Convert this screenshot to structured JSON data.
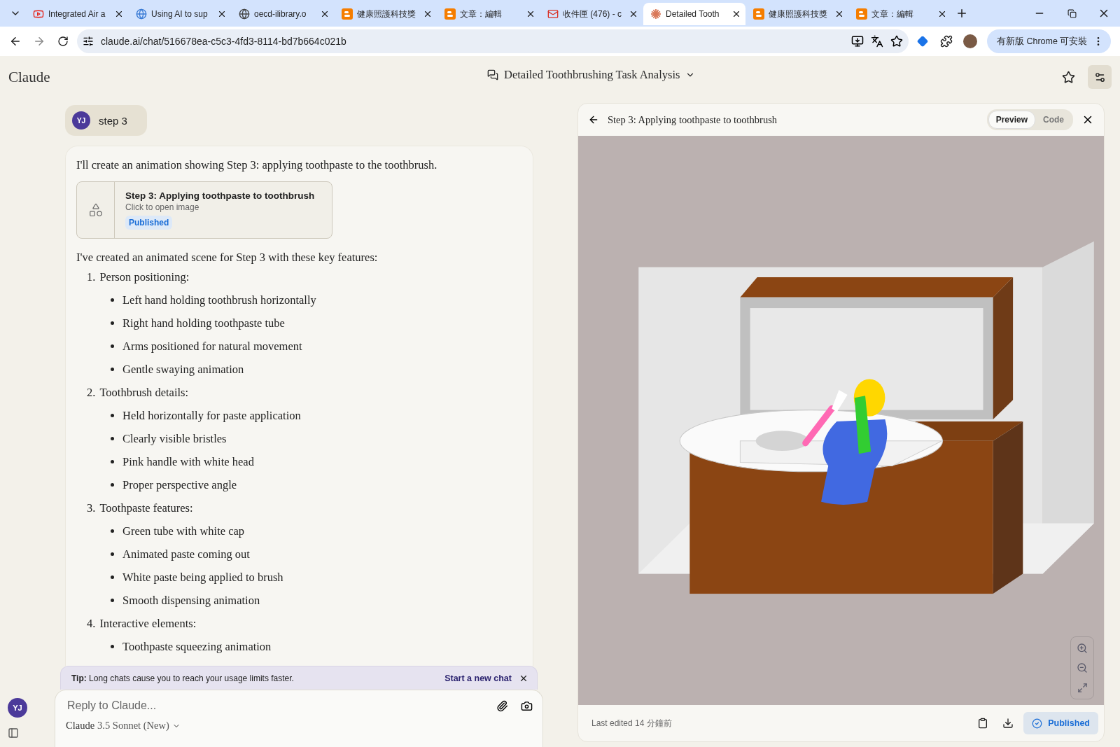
{
  "browser": {
    "tabs": [
      {
        "title": "Integrated Air a",
        "selected": false
      },
      {
        "title": "Using AI to sup",
        "selected": false
      },
      {
        "title": "oecd-ilibrary.o",
        "selected": false
      },
      {
        "title": "健康照護科技獎",
        "selected": false
      },
      {
        "title": "文章：編輯",
        "selected": false
      },
      {
        "title": "收件匣 (476) - c",
        "selected": false
      },
      {
        "title": "Detailed Tooth",
        "selected": true
      },
      {
        "title": "健康照護科技獎",
        "selected": false
      },
      {
        "title": "文章：編輯",
        "selected": false
      }
    ],
    "url": "claude.ai/chat/516678ea-c5c3-4fd3-8114-bd7b664c021b",
    "update_button": "有新版 Chrome 可安裝"
  },
  "app": {
    "brand": "Claude",
    "chat_title": "Detailed Toothbrushing Task Analysis",
    "user_initials": "YJ"
  },
  "user_message": {
    "initials": "YJ",
    "text": "step 3"
  },
  "response": {
    "intro": "I'll create an animation showing Step 3: applying toothpaste to the toothbrush.",
    "artifact_card": {
      "title": "Step 3: Applying toothpaste to toothbrush",
      "subtitle": "Click to open image",
      "badge": "Published"
    },
    "summary": "I've created an animated scene for Step 3 with these key features:",
    "sections": [
      {
        "number": "1.",
        "title": "Person positioning:",
        "items": [
          "Left hand holding toothbrush horizontally",
          "Right hand holding toothpaste tube",
          "Arms positioned for natural movement",
          "Gentle swaying animation"
        ]
      },
      {
        "number": "2.",
        "title": "Toothbrush details:",
        "items": [
          "Held horizontally for paste application",
          "Clearly visible bristles",
          "Pink handle with white head",
          "Proper perspective angle"
        ]
      },
      {
        "number": "3.",
        "title": "Toothpaste features:",
        "items": [
          "Green tube with white cap",
          "Animated paste coming out",
          "White paste being applied to brush",
          "Smooth dispensing animation"
        ]
      },
      {
        "number": "4.",
        "title": "Interactive elements:",
        "items": [
          "Toothpaste squeezing animation"
        ]
      }
    ]
  },
  "tip": {
    "text": "**Tip:** Long chats cause you to reach your usage limits faster.",
    "action": "Start a new chat"
  },
  "composer": {
    "placeholder": "Reply to Claude...",
    "model_name": "Claude",
    "model_version": "3.5 Sonnet (New)"
  },
  "panel": {
    "title": "Step 3: Applying toothpaste to toothbrush",
    "tabs": [
      {
        "label": "Preview",
        "selected": true
      },
      {
        "label": "Code",
        "selected": false
      }
    ],
    "footer": {
      "edited": "Last edited 14 分鐘前",
      "published": "Published"
    }
  }
}
